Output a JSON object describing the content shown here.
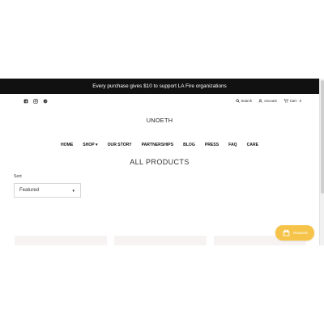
{
  "announcement": "Every purchase gives $10 to support LA Fire organizations",
  "utility": {
    "search": "Search",
    "account": "Account",
    "cart": "Cart · 0"
  },
  "logo": "UNOETH",
  "nav": [
    "HOME",
    "SHOP ▾",
    "OUR STORY",
    "PARTNERSHIPS",
    "BLOG",
    "PRESS",
    "FAQ",
    "CARE"
  ],
  "page_title": "ALL PRODUCTS",
  "sort": {
    "label": "Sort",
    "selected": "Featured"
  },
  "rewards_label": "Rewards",
  "icons": [
    "facebook-icon",
    "instagram-icon",
    "pinterest-icon",
    "search-icon",
    "account-icon",
    "cart-icon",
    "gift-icon",
    "caret-down-icon"
  ],
  "colors": {
    "announcement_bg": "#111111",
    "rewards": "#F6C44A",
    "card_bg": "#F7F3F3"
  }
}
